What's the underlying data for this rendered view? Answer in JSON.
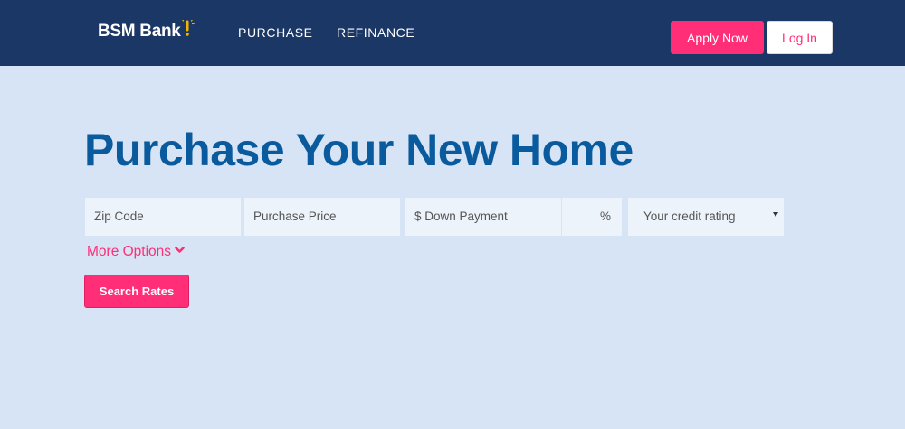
{
  "header": {
    "logo_text": "BSM Bank",
    "nav": [
      {
        "label": "PURCHASE"
      },
      {
        "label": "REFINANCE"
      }
    ],
    "apply_label": "Apply Now",
    "login_label": "Log In"
  },
  "main": {
    "title": "Purchase Your New Home",
    "form": {
      "zip_placeholder": "Zip Code",
      "price_placeholder": "Purchase Price",
      "down_payment_placeholder": "$ Down Payment",
      "percent_placeholder": "%",
      "credit_rating_selected": "Your credit rating",
      "more_options_label": "More Options",
      "search_label": "Search Rates"
    }
  },
  "colors": {
    "navbar": "#1b3765",
    "page_background": "#d7e4f5",
    "accent": "#ff2e77",
    "title": "#0a5a9e",
    "field_background": "#edf3fb",
    "logo_mark": "#f5b400"
  },
  "icons": {
    "logo_mark": "lightbulb-icon",
    "more_options": "chevron-down-icon",
    "select_caret": "caret-down-icon"
  }
}
